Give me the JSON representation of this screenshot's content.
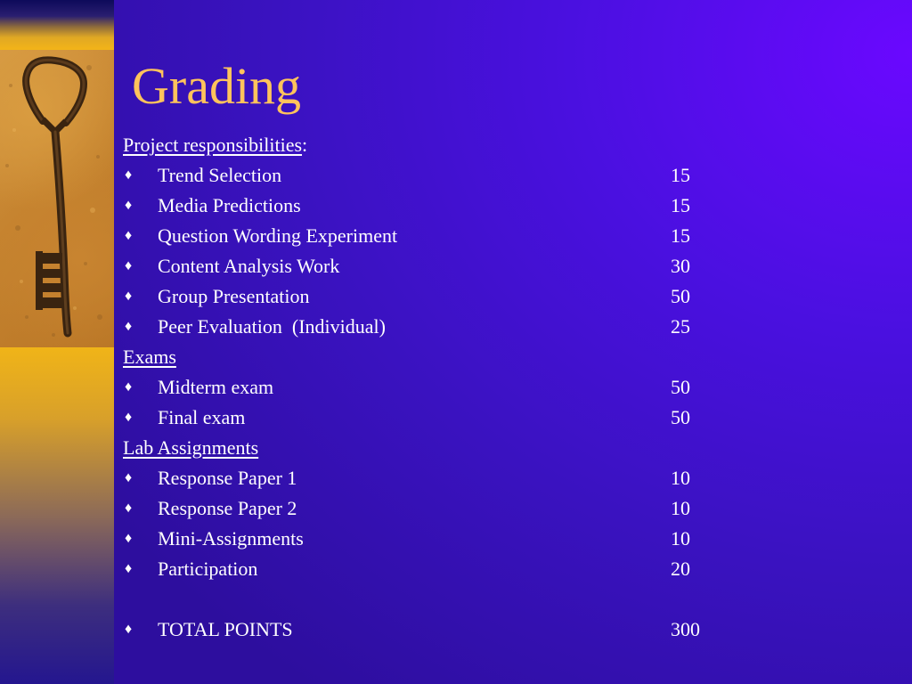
{
  "slide": {
    "title": "Grading",
    "bullet_glyph": "♦",
    "sections": [
      {
        "heading": "Project responsibilities",
        "heading_suffix": ":",
        "items": [
          {
            "label": "Trend Selection",
            "points": "15"
          },
          {
            "label": "Media Predictions",
            "points": "15"
          },
          {
            "label": "Question Wording Experiment",
            "points": "15"
          },
          {
            "label": "Content Analysis Work",
            "points": "30"
          },
          {
            "label": "Group Presentation",
            "points": "50"
          },
          {
            "label": "Peer Evaluation  (Individual)",
            "points": "25"
          }
        ]
      },
      {
        "heading": "Exams",
        "heading_suffix": "",
        "items": [
          {
            "label": "Midterm exam",
            "points": "50"
          },
          {
            "label": "Final exam",
            "points": "50"
          }
        ]
      },
      {
        "heading": "Lab Assignments",
        "heading_suffix": "",
        "items": [
          {
            "label": "Response Paper 1",
            "points": "10"
          },
          {
            "label": "Response Paper 2",
            "points": "10"
          },
          {
            "label": "Mini-Assignments",
            "points": "10"
          },
          {
            "label": "Participation",
            "points": "20"
          }
        ]
      }
    ],
    "total": {
      "label": "TOTAL POINTS",
      "points": "300"
    },
    "colors": {
      "title": "#ffc35c",
      "text": "#ffffff",
      "background": "#3a12c0",
      "sidebar": "#f3b418"
    },
    "icons": {
      "bullet": "diamond-bullet-icon",
      "decoration": "skeleton-key-icon"
    }
  }
}
